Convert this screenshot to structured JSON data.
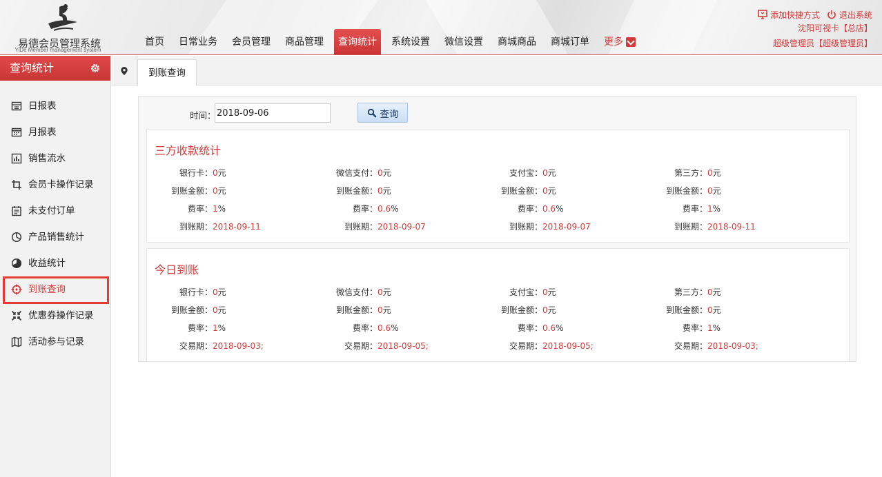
{
  "brand": {
    "title": "易德会员管理系统",
    "subtitle": "YiDe Member management system"
  },
  "nav": {
    "items": [
      "首页",
      "日常业务",
      "会员管理",
      "商品管理",
      "查询统计",
      "系统设置",
      "微信设置",
      "商城商品",
      "商城订单"
    ],
    "active_index": 4,
    "more_label": "更多"
  },
  "topright": {
    "add_shortcut": "添加快捷方式",
    "logout": "退出系统",
    "store": "沈阳可视卡【总店】",
    "user": "超级管理员【超级管理员】"
  },
  "sidebar": {
    "title": "查询统计",
    "items": [
      {
        "label": "日报表",
        "icon": "calendar-icon"
      },
      {
        "label": "月报表",
        "icon": "calendar-month-icon"
      },
      {
        "label": "销售流水",
        "icon": "bar-chart-icon"
      },
      {
        "label": "会员卡操作记录",
        "icon": "crop-icon"
      },
      {
        "label": "未支付订单",
        "icon": "order-icon"
      },
      {
        "label": "产品销售统计",
        "icon": "pie-chart-icon"
      },
      {
        "label": "收益统计",
        "icon": "half-pie-icon"
      },
      {
        "label": "到账查询",
        "icon": "crosshair-icon"
      },
      {
        "label": "优惠券操作记录",
        "icon": "shrink-icon"
      },
      {
        "label": "活动参与记录",
        "icon": "map-icon"
      }
    ],
    "active_index": 7
  },
  "tabs": {
    "items": [
      {
        "label": "到账查询"
      }
    ]
  },
  "query": {
    "label": "时间：",
    "value": "2018-09-06",
    "button": "查询"
  },
  "sections": [
    {
      "title": "三方收款统计",
      "rows": [
        [
          {
            "label": "银行卡：",
            "value": "0",
            "unit": "元"
          },
          {
            "label": "微信支付：",
            "value": "0",
            "unit": "元"
          },
          {
            "label": "支付宝：",
            "value": "0",
            "unit": "元"
          },
          {
            "label": "第三方：",
            "value": "0",
            "unit": "元"
          }
        ],
        [
          {
            "label": "到账金额：",
            "value": "0",
            "unit": "元"
          },
          {
            "label": "到账金额：",
            "value": "0",
            "unit": "元"
          },
          {
            "label": "到账金额：",
            "value": "0",
            "unit": "元"
          },
          {
            "label": "到账金额：",
            "value": "0",
            "unit": "元"
          }
        ],
        [
          {
            "label": "费率：",
            "value": "1",
            "unit": "%"
          },
          {
            "label": "费率：",
            "value": "0.6",
            "unit": "%"
          },
          {
            "label": "费率：",
            "value": "0.6",
            "unit": "%"
          },
          {
            "label": "费率：",
            "value": "1",
            "unit": "%"
          }
        ],
        [
          {
            "label": "到账期：",
            "value": "2018-09-11",
            "unit": ""
          },
          {
            "label": "到账期：",
            "value": "2018-09-07",
            "unit": ""
          },
          {
            "label": "到账期：",
            "value": "2018-09-07",
            "unit": ""
          },
          {
            "label": "到账期：",
            "value": "2018-09-11",
            "unit": ""
          }
        ]
      ]
    },
    {
      "title": "今日到账",
      "rows": [
        [
          {
            "label": "银行卡：",
            "value": "0",
            "unit": "元"
          },
          {
            "label": "微信支付：",
            "value": "0",
            "unit": "元"
          },
          {
            "label": "支付宝：",
            "value": "0",
            "unit": "元"
          },
          {
            "label": "第三方：",
            "value": "0",
            "unit": "元"
          }
        ],
        [
          {
            "label": "到账金额：",
            "value": "0",
            "unit": "元"
          },
          {
            "label": "到账金额：",
            "value": "0",
            "unit": "元"
          },
          {
            "label": "到账金额：",
            "value": "0",
            "unit": "元"
          },
          {
            "label": "到账金额：",
            "value": "0",
            "unit": "元"
          }
        ],
        [
          {
            "label": "费率：",
            "value": "1",
            "unit": "%"
          },
          {
            "label": "费率：",
            "value": "0.6",
            "unit": "%"
          },
          {
            "label": "费率：",
            "value": "0.6",
            "unit": "%"
          },
          {
            "label": "费率：",
            "value": "1",
            "unit": "%"
          }
        ],
        [
          {
            "label": "交易期：",
            "value": "2018-09-03;",
            "unit": ""
          },
          {
            "label": "交易期：",
            "value": "2018-09-05;",
            "unit": ""
          },
          {
            "label": "交易期：",
            "value": "2018-09-05;",
            "unit": ""
          },
          {
            "label": "交易期：",
            "value": "2018-09-03;",
            "unit": ""
          }
        ]
      ]
    }
  ],
  "colors": {
    "accent": "#d23b3b",
    "highlight_border": "#e53935"
  }
}
